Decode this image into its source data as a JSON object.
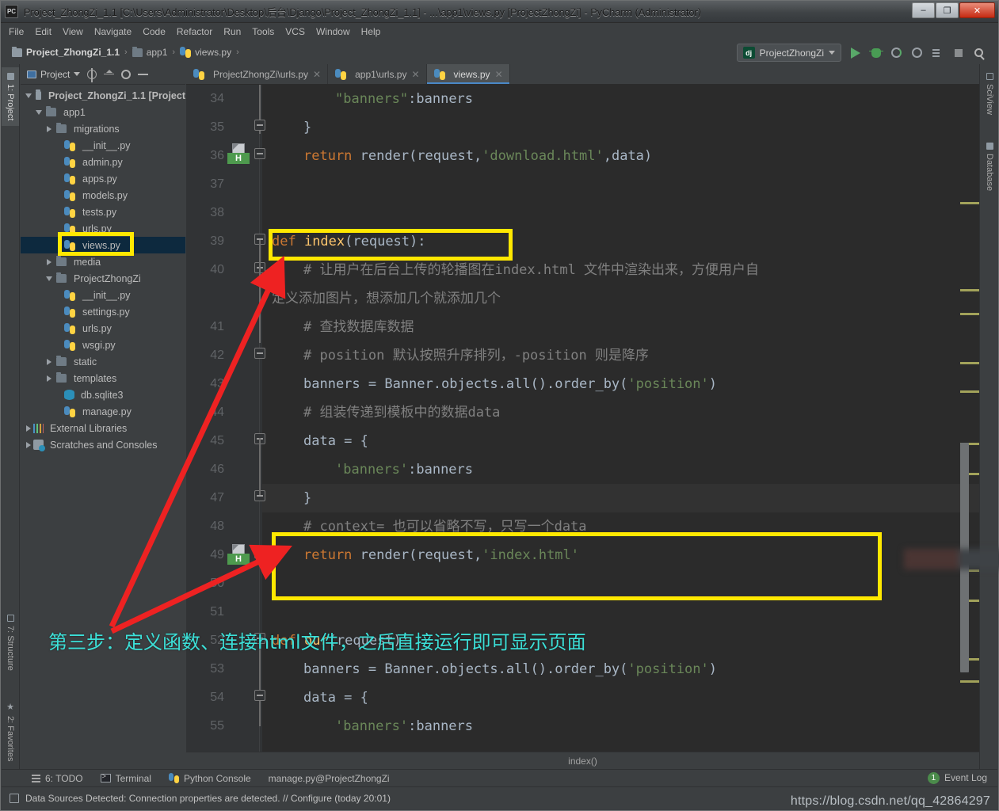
{
  "window": {
    "title": "Project_ZhongZi_1.1 [C:\\Users\\Administrator\\Desktop\\后台\\Django\\Project_ZhongZi_1.1] - ...\\app1\\views.py [ProjectZhongZi] - PyCharm (Administrator)",
    "app_badge": "PC",
    "minimize": "–",
    "maximize": "❐",
    "close": "✕"
  },
  "menu": {
    "items": [
      "File",
      "Edit",
      "View",
      "Navigate",
      "Code",
      "Refactor",
      "Run",
      "Tools",
      "VCS",
      "Window",
      "Help"
    ]
  },
  "breadcrumb": {
    "items": [
      "Project_ZhongZi_1.1",
      "app1",
      "views.py"
    ],
    "separator": "›"
  },
  "run_widget": {
    "config_badge": "dj",
    "config_name": "ProjectZhongZi",
    "buttons": [
      "run-button",
      "debug-button",
      "run-coverage-button",
      "profile-button",
      "run-with-console-button",
      "stop-button",
      "search-everywhere-button"
    ]
  },
  "left_strip": {
    "tabs": [
      {
        "label": "1: Project",
        "active": true
      },
      {
        "label": "7: Structure",
        "active": false
      },
      {
        "label": "2: Favorites",
        "active": false
      }
    ]
  },
  "right_strip": {
    "tabs": [
      {
        "label": "SciView"
      },
      {
        "label": "Database"
      }
    ]
  },
  "project_panel": {
    "title": "Project",
    "toolbar_icons": [
      "locate-icon",
      "collapse-all-icon",
      "settings-gear-icon",
      "hide-icon"
    ],
    "tree": [
      {
        "depth": 0,
        "arrow": "down",
        "icon": "folder",
        "label": "Project_ZhongZi_1.1 [Project",
        "bold": true
      },
      {
        "depth": 1,
        "arrow": "down",
        "icon": "folder-module",
        "label": "app1"
      },
      {
        "depth": 2,
        "arrow": "right",
        "icon": "folder-module",
        "label": "migrations"
      },
      {
        "depth": 3,
        "arrow": "none",
        "icon": "python",
        "label": "__init__.py"
      },
      {
        "depth": 3,
        "arrow": "none",
        "icon": "python",
        "label": "admin.py"
      },
      {
        "depth": 3,
        "arrow": "none",
        "icon": "python",
        "label": "apps.py"
      },
      {
        "depth": 3,
        "arrow": "none",
        "icon": "python",
        "label": "models.py"
      },
      {
        "depth": 3,
        "arrow": "none",
        "icon": "python",
        "label": "tests.py"
      },
      {
        "depth": 3,
        "arrow": "none",
        "icon": "python",
        "label": "urls.py"
      },
      {
        "depth": 3,
        "arrow": "none",
        "icon": "python",
        "label": "views.py",
        "selected": true
      },
      {
        "depth": 2,
        "arrow": "right",
        "icon": "folder-module",
        "label": "media"
      },
      {
        "depth": 2,
        "arrow": "down",
        "icon": "folder-module",
        "label": "ProjectZhongZi"
      },
      {
        "depth": 3,
        "arrow": "none",
        "icon": "python",
        "label": "__init__.py"
      },
      {
        "depth": 3,
        "arrow": "none",
        "icon": "python",
        "label": "settings.py"
      },
      {
        "depth": 3,
        "arrow": "none",
        "icon": "python",
        "label": "urls.py"
      },
      {
        "depth": 3,
        "arrow": "none",
        "icon": "python",
        "label": "wsgi.py"
      },
      {
        "depth": 2,
        "arrow": "right",
        "icon": "folder-module",
        "label": "static"
      },
      {
        "depth": 2,
        "arrow": "right",
        "icon": "folder-module",
        "label": "templates"
      },
      {
        "depth": 3,
        "arrow": "none",
        "icon": "database",
        "label": "db.sqlite3"
      },
      {
        "depth": 3,
        "arrow": "none",
        "icon": "python",
        "label": "manage.py"
      },
      {
        "depth": 0,
        "arrow": "right",
        "icon": "library",
        "label": "External Libraries"
      },
      {
        "depth": 0,
        "arrow": "right",
        "icon": "scratches",
        "label": "Scratches and Consoles"
      }
    ]
  },
  "editor_tabs": [
    {
      "label": "ProjectZhongZi\\urls.py",
      "active": false,
      "close": "✕"
    },
    {
      "label": "app1\\urls.py",
      "active": false,
      "close": "✕"
    },
    {
      "label": "views.py",
      "active": true,
      "close": "✕"
    }
  ],
  "code": {
    "lines": [
      {
        "num": "34",
        "indent": 4,
        "tokens": [
          {
            "t": "\"banners\"",
            "c": "str"
          },
          {
            "t": ":",
            "c": "pln"
          },
          {
            "t": "banners",
            "c": "pln"
          }
        ]
      },
      {
        "num": "35",
        "indent": 2,
        "tokens": [
          {
            "t": "}",
            "c": "pln"
          }
        ]
      },
      {
        "num": "36",
        "indent": 2,
        "tokens": [
          {
            "t": "return ",
            "c": "kw"
          },
          {
            "t": "render(request,",
            "c": "pln"
          },
          {
            "t": "'download.html'",
            "c": "str"
          },
          {
            "t": ",data)",
            "c": "pln"
          }
        ]
      },
      {
        "num": "37",
        "indent": 0,
        "tokens": []
      },
      {
        "num": "38",
        "indent": 0,
        "tokens": []
      },
      {
        "num": "39",
        "indent": 0,
        "tokens": [
          {
            "t": "def ",
            "c": "kw"
          },
          {
            "t": "index",
            "c": "fn"
          },
          {
            "t": "(request):",
            "c": "pln"
          }
        ]
      },
      {
        "num": "40",
        "indent": 2,
        "tokens": [
          {
            "t": "# 让用户在后台上传的轮播图在index.html 文件中渲染出来，方便用户自",
            "c": "cmt"
          }
        ]
      },
      {
        "num": "",
        "indent": 0,
        "tokens": [
          {
            "t": "定义添加图片，想添加几个就添加几个",
            "c": "cmt"
          }
        ]
      },
      {
        "num": "41",
        "indent": 2,
        "tokens": [
          {
            "t": "# 查找数据库数据",
            "c": "cmt"
          }
        ]
      },
      {
        "num": "42",
        "indent": 2,
        "tokens": [
          {
            "t": "# position 默认按照升序排列，-position 则是降序",
            "c": "cmt"
          }
        ]
      },
      {
        "num": "43",
        "indent": 2,
        "tokens": [
          {
            "t": "banners = Banner.objects.all().order_by(",
            "c": "pln"
          },
          {
            "t": "'position'",
            "c": "str"
          },
          {
            "t": ")",
            "c": "pln"
          }
        ]
      },
      {
        "num": "44",
        "indent": 2,
        "tokens": [
          {
            "t": "# 组装传递到模板中的数据data",
            "c": "cmt"
          }
        ]
      },
      {
        "num": "45",
        "indent": 2,
        "tokens": [
          {
            "t": "data = {",
            "c": "pln"
          }
        ]
      },
      {
        "num": "46",
        "indent": 4,
        "tokens": [
          {
            "t": "'banners'",
            "c": "str"
          },
          {
            "t": ":banners",
            "c": "pln"
          }
        ]
      },
      {
        "num": "47",
        "indent": 2,
        "tokens": [
          {
            "t": "}",
            "c": "pln"
          }
        ],
        "current": true
      },
      {
        "num": "48",
        "indent": 2,
        "tokens": [
          {
            "t": "# context= 也可以省略不写，只写一个data",
            "c": "cmt"
          }
        ]
      },
      {
        "num": "49",
        "indent": 2,
        "tokens": [
          {
            "t": "return ",
            "c": "kw"
          },
          {
            "t": "render(request,",
            "c": "pln"
          },
          {
            "t": "'index.html'",
            "c": "str"
          },
          {
            "t": "",
            "c": "pln"
          }
        ]
      },
      {
        "num": "50",
        "indent": 0,
        "tokens": []
      },
      {
        "num": "51",
        "indent": 0,
        "tokens": []
      },
      {
        "num": "52",
        "indent": 0,
        "tokens": [
          {
            "t": "def ",
            "c": "kw"
          },
          {
            "t": "our",
            "c": "fn"
          },
          {
            "t": "(request):",
            "c": "pln"
          }
        ]
      },
      {
        "num": "53",
        "indent": 2,
        "tokens": [
          {
            "t": "banners = Banner.objects.all().order_by(",
            "c": "pln"
          },
          {
            "t": "'position'",
            "c": "str"
          },
          {
            "t": ")",
            "c": "pln"
          }
        ]
      },
      {
        "num": "54",
        "indent": 2,
        "tokens": [
          {
            "t": "data = {",
            "c": "pln"
          }
        ]
      },
      {
        "num": "55",
        "indent": 4,
        "tokens": [
          {
            "t": "'banners'",
            "c": "str"
          },
          {
            "t": ":banners",
            "c": "pln"
          }
        ]
      }
    ],
    "redacted_tail": ")",
    "gutter_html_badge": "H"
  },
  "editor_breadcrumb": {
    "text": "index()"
  },
  "annotations": {
    "highlight_boxes": [
      "def index(request): box",
      "return render index.html box"
    ],
    "note": "第三步：定义函数、连接html文件，之后直接运行即可显示页面",
    "arrow_color": "#ee2222",
    "box_color": "#ffe800",
    "note_color": "#3ce0d8"
  },
  "bottom_tools": {
    "items": [
      {
        "label": "6: TODO",
        "icon": "todo-icon"
      },
      {
        "label": "Terminal",
        "icon": "terminal-icon"
      },
      {
        "label": "Python Console",
        "icon": "python-console-icon"
      },
      {
        "label": "manage.py@ProjectZhongZi",
        "icon": "none"
      }
    ],
    "event_log": {
      "count": "1",
      "label": "Event Log"
    }
  },
  "status_bar": {
    "text": "Data Sources Detected: Connection properties are detected. // Configure (today 20:01)"
  },
  "watermark": {
    "text": "https://blog.csdn.net/qq_42864297"
  }
}
